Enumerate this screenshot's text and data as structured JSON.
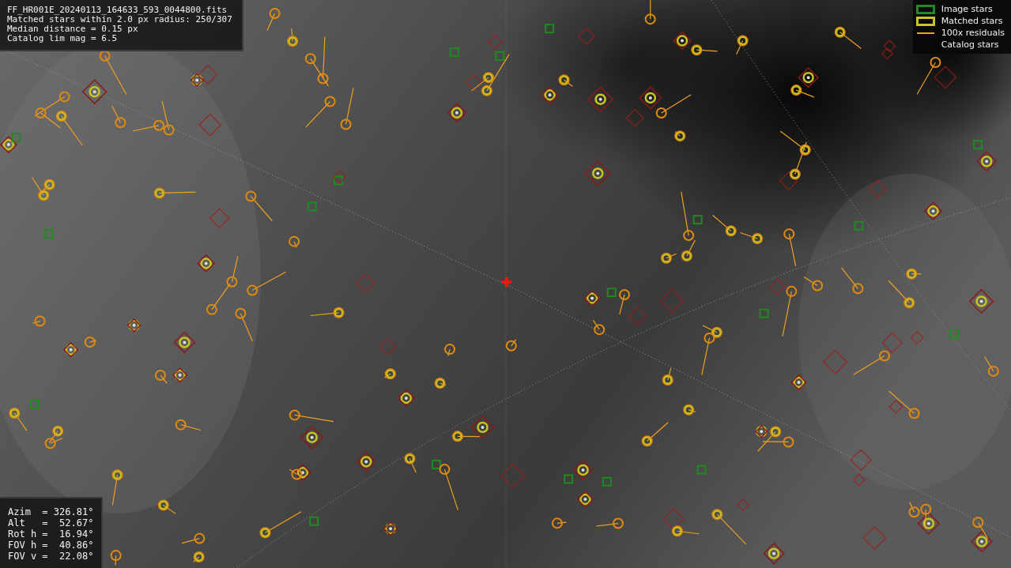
{
  "info_panel": {
    "lines": [
      "FF_HR001E_20240113_164633_593_0044800.fits",
      "Matched stars within 2.0 px radius: 250/307",
      "Median distance = 0.15 px",
      "Catalog lim mag = 6.5"
    ]
  },
  "pointing_panel": {
    "lines": [
      "Azim  = 326.81°",
      "Alt   =  52.67°",
      "Rot h =  16.94°",
      "FOV h =  40.86°",
      "FOV v =  22.08°"
    ]
  },
  "legend": {
    "items": [
      {
        "kind": "box",
        "label": "Image stars",
        "color": "#1f8a1f"
      },
      {
        "kind": "box",
        "label": "Matched stars",
        "color": "#c9c41e"
      },
      {
        "kind": "line",
        "label": "100x residuals",
        "color": "#f0a020"
      },
      {
        "kind": "catalog",
        "label": "Catalog stars"
      }
    ]
  }
}
